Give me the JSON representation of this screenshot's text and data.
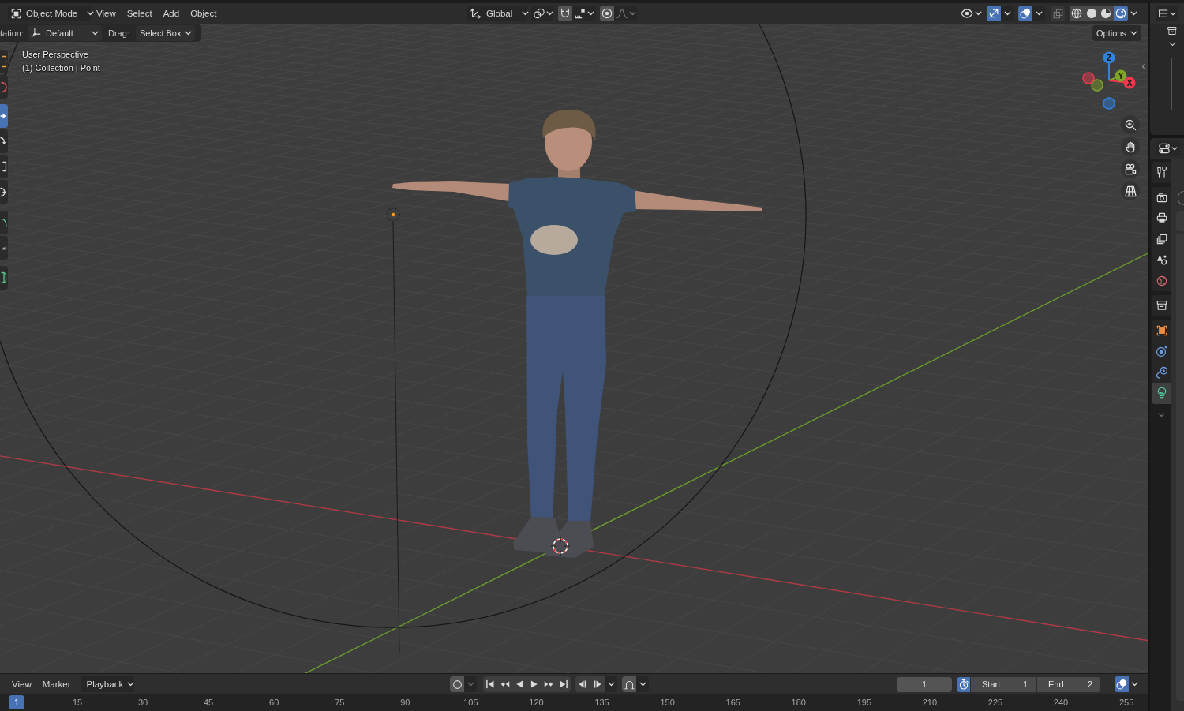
{
  "header": {
    "mode": {
      "label": "Object Mode"
    },
    "menus": [
      {
        "label": "View"
      },
      {
        "label": "Select"
      },
      {
        "label": "Add"
      },
      {
        "label": "Object"
      }
    ],
    "transform_orientation": {
      "label": "Global"
    },
    "snapping": {
      "on": false
    },
    "proportional_editing": {
      "on": false
    },
    "gizmos": {
      "on": true
    },
    "overlays": {
      "on": true
    },
    "xray": {
      "on": false
    },
    "shading_modes": [
      {
        "kind": "wireframe",
        "selected": false
      },
      {
        "kind": "solid",
        "selected": false
      },
      {
        "kind": "material",
        "selected": false
      },
      {
        "kind": "rendered",
        "selected": true
      }
    ]
  },
  "tool_settings": {
    "orientation": {
      "label": "tation:",
      "value": "Default"
    },
    "drag": {
      "label": "Drag:",
      "value": "Select Box"
    },
    "options": {
      "label": "Options"
    }
  },
  "viewport": {
    "view_name": "User Perspective",
    "context": "(1) Collection | Point"
  },
  "left_toolbar": {
    "tools": [
      {
        "kind": "select_box",
        "selected": false
      },
      {
        "kind": "cursor",
        "selected": false
      },
      {
        "kind": "move",
        "selected": true
      },
      {
        "kind": "rotate",
        "selected": false
      },
      {
        "kind": "scale",
        "selected": false
      },
      {
        "kind": "transform",
        "selected": false
      },
      {
        "kind": "annotate",
        "selected": false
      },
      {
        "kind": "measure",
        "selected": false
      },
      {
        "kind": "add_cube",
        "selected": false
      }
    ]
  },
  "gizmo": {
    "axes": [
      {
        "label": "Z",
        "color": "#2f83e3"
      },
      {
        "label": "Y",
        "color": "#7ea52a"
      },
      {
        "label": "X",
        "color": "#f0394f"
      }
    ]
  },
  "navigation": [
    {
      "kind": "zoom"
    },
    {
      "kind": "pan"
    },
    {
      "kind": "camera"
    },
    {
      "kind": "perspective"
    }
  ],
  "timeline": {
    "menus": [
      {
        "label": "View"
      },
      {
        "label": "Marker"
      }
    ],
    "playback": {
      "label": "Playback"
    },
    "auto_keying": {
      "on": false
    },
    "current_frame": "1",
    "preview_range": {
      "on": true
    },
    "start": {
      "label": "Start",
      "value": "1"
    },
    "end": {
      "label": "End",
      "value": "2"
    },
    "overlays": {
      "on": true
    },
    "ruler": {
      "current": "1",
      "ticks": [
        "15",
        "30",
        "45",
        "60",
        "75",
        "90",
        "105",
        "120",
        "135",
        "150",
        "165",
        "180",
        "195",
        "210",
        "225",
        "240",
        "255"
      ]
    }
  },
  "outliner": {
    "expanded": true
  },
  "properties": {
    "tabs": [
      {
        "kind": "tool",
        "selected": false
      },
      {
        "kind": "render",
        "selected": false
      },
      {
        "kind": "output",
        "selected": false
      },
      {
        "kind": "view_layer",
        "selected": false
      },
      {
        "kind": "scene",
        "selected": false
      },
      {
        "kind": "world",
        "selected": false
      },
      {
        "kind": "collection",
        "selected": false
      },
      {
        "kind": "object",
        "selected": false
      },
      {
        "kind": "physics",
        "selected": false
      },
      {
        "kind": "constraints",
        "selected": false
      },
      {
        "kind": "light_data",
        "selected": true
      }
    ]
  }
}
